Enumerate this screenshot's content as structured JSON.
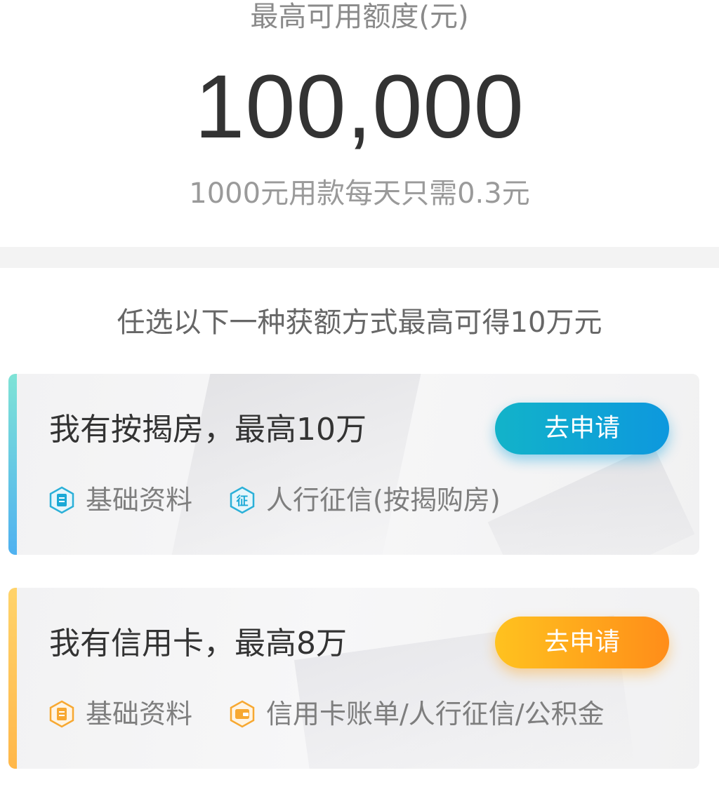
{
  "limit": {
    "title": "最高可用额度(元)",
    "amount": "100,000",
    "note": "1000元用款每天只需0.3元"
  },
  "options_heading": "任选以下一种获额方式最高可得10万元",
  "cards": [
    {
      "title": "我有按揭房，最高10万",
      "button_label": "去申请",
      "accent_color": "#0d98de",
      "requirements": [
        {
          "icon": "document-icon",
          "label": "基础资料"
        },
        {
          "icon": "credit-report-icon",
          "icon_text": "征",
          "label": "人行征信(按揭购房)"
        }
      ]
    },
    {
      "title": "我有信用卡，最高8万",
      "button_label": "去申请",
      "accent_color": "#ff8d19",
      "requirements": [
        {
          "icon": "document-icon",
          "label": "基础资料"
        },
        {
          "icon": "wallet-icon",
          "label": "信用卡账单/人行征信/公积金"
        }
      ]
    }
  ]
}
